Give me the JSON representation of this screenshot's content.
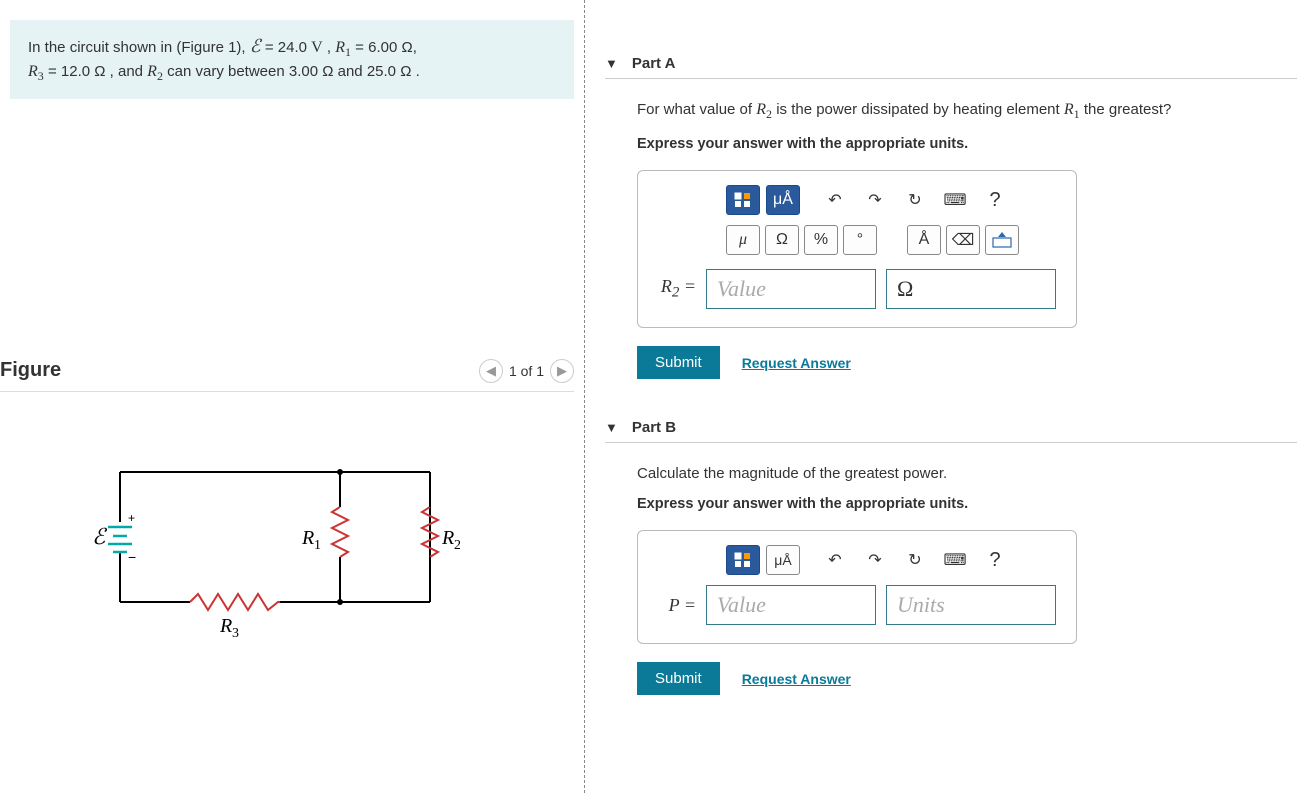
{
  "problem": {
    "line1_prefix": "In the circuit shown in (Figure 1), ",
    "emf_sym": "ℰ",
    "emf_val": " = 24.0 ",
    "emf_unit": "V",
    "r1_sym": "R",
    "r1_sub": "1",
    "r1_val": " = 6.00 ",
    "r1_unit": "Ω",
    "r3_sym": "R",
    "r3_sub": "3",
    "r3_val": " = 12.0 ",
    "r3_unit": "Ω",
    "r2_text": ", and ",
    "r2_sym": "R",
    "r2_sub": "2",
    "r2_range": " can vary between 3.00 ",
    "r2_unit1": "Ω",
    "r2_and": " and 25.0 ",
    "r2_unit2": "Ω",
    "period": " ."
  },
  "figure": {
    "title": "Figure",
    "pager": "1 of 1"
  },
  "partA": {
    "title": "Part A",
    "question_prefix": "For what value of ",
    "q_r2": "R",
    "q_r2_sub": "2",
    "question_mid": " is the power dissipated by heating element ",
    "q_r1": "R",
    "q_r1_sub": "1",
    "question_suffix": " the greatest?",
    "instruction": "Express your answer with the appropriate units.",
    "toolbar": {
      "templates": "⊞",
      "units_btn": "μÅ",
      "undo": "↶",
      "redo": "↷",
      "reset": "↻",
      "keyboard": "⌨",
      "help": "?",
      "mu": "μ",
      "omega": "Ω",
      "percent": "%",
      "degree": "°",
      "angstrom": "Å",
      "backspace": "⌫",
      "kbd2": "⌨"
    },
    "answer": {
      "label": "R₂ =",
      "value_placeholder": "Value",
      "units": "Ω"
    },
    "submit": "Submit",
    "request": "Request Answer"
  },
  "partB": {
    "title": "Part B",
    "question": "Calculate the magnitude of the greatest power.",
    "instruction": "Express your answer with the appropriate units.",
    "toolbar": {
      "templates": "⊞",
      "units_btn": "μÅ",
      "undo": "↶",
      "redo": "↷",
      "reset": "↻",
      "keyboard": "⌨",
      "help": "?"
    },
    "answer": {
      "label": "P =",
      "value_placeholder": "Value",
      "units_placeholder": "Units"
    },
    "submit": "Submit",
    "request": "Request Answer"
  }
}
